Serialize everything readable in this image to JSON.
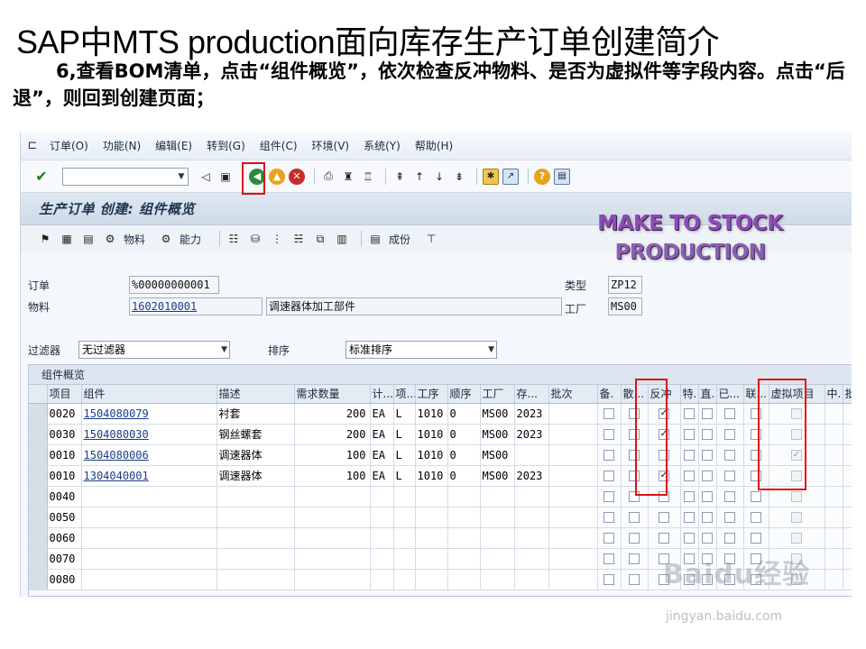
{
  "slide": {
    "title": "SAP中MTS production面向库存生产订单创建简介",
    "description": "6,查看BOM清单，点击“组件概览”，依次检查反冲物料、是否为虚拟件等字段内容。点击“后退”，则回到创建页面；"
  },
  "menubar": {
    "items": [
      "订单(O)",
      "功能(N)",
      "编辑(E)",
      "转到(G)",
      "组件(C)",
      "环境(V)",
      "系统(Y)",
      "帮助(H)"
    ]
  },
  "toolbar": {
    "command_value": ""
  },
  "screen": {
    "title": "生产订单 创建: 组件概览"
  },
  "apptoolbar": {
    "materials_label": "物料",
    "capacity_label": "能力",
    "costing_label": "成份"
  },
  "watermark": {
    "line1": "MAKE TO STOCK",
    "line2": "PRODUCTION"
  },
  "header_fields": {
    "order_label": "订单",
    "order_value": "%00000000001",
    "material_label": "物料",
    "material_value": "1602010001",
    "material_desc": "调速器体加工部件",
    "type_label": "类型",
    "type_value": "ZP12",
    "plant_label": "工厂",
    "plant_value": "MS00"
  },
  "filter": {
    "filter_label": "过滤器",
    "filter_value": "无过滤器",
    "sort_label": "排序",
    "sort_value": "标准排序"
  },
  "grid": {
    "title": "组件概览",
    "columns": [
      "项目",
      "组件",
      "描述",
      "需求数量",
      "计...",
      "项...",
      "工序",
      "顺序",
      "工厂",
      "存...",
      "批次",
      "备.",
      "散...",
      "反冲",
      "特.",
      "直.",
      "已...",
      "联...",
      "虚拟项目",
      "中.",
      "批."
    ],
    "rows": [
      {
        "item": "0020",
        "component": "1504080079",
        "desc": "衬套",
        "qty": "200",
        "unit": "EA",
        "cat": "L",
        "op": "1010",
        "seq": "0",
        "plant": "MS00",
        "sloc": "2023",
        "backflush": true,
        "phantom": false
      },
      {
        "item": "0030",
        "component": "1504080030",
        "desc": "钢丝螺套",
        "qty": "200",
        "unit": "EA",
        "cat": "L",
        "op": "1010",
        "seq": "0",
        "plant": "MS00",
        "sloc": "2023",
        "backflush": true,
        "phantom": false
      },
      {
        "item": "0010",
        "component": "1504080006",
        "desc": "调速器体",
        "qty": "100",
        "unit": "EA",
        "cat": "L",
        "op": "1010",
        "seq": "0",
        "plant": "MS00",
        "sloc": "",
        "backflush": false,
        "phantom": true
      },
      {
        "item": "0010",
        "component": "1304040001",
        "desc": "调速器体",
        "qty": "100",
        "unit": "EA",
        "cat": "L",
        "op": "1010",
        "seq": "0",
        "plant": "MS00",
        "sloc": "2023",
        "backflush": true,
        "phantom": false
      },
      {
        "item": "0040"
      },
      {
        "item": "0050"
      },
      {
        "item": "0060"
      },
      {
        "item": "0070"
      },
      {
        "item": "0080"
      }
    ]
  },
  "baidu": {
    "logo": "Baidu经验",
    "sub": "jingyan.baidu.com"
  }
}
